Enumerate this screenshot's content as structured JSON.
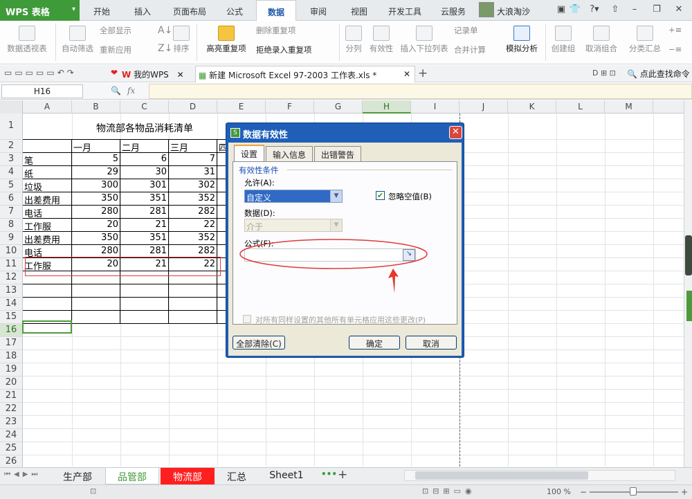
{
  "app": {
    "logo": "WPS 表格"
  },
  "menu_tabs": [
    "开始",
    "插入",
    "页面布局",
    "公式",
    "数据",
    "审阅",
    "视图",
    "开发工具",
    "云服务"
  ],
  "user_name": "大浪淘沙",
  "ribbon": {
    "pivot": "数据透视表",
    "autofilter": "自动筛选",
    "show_all": "全部显示",
    "reapply": "重新应用",
    "sort": "排序",
    "highlight_dup": "高亮重复项",
    "delete_dup": "删除重复项",
    "reject_dup": "拒绝录入重复项",
    "split": "分列",
    "validity": "有效性",
    "insert_dropdown": "插入下拉列表",
    "record": "记录单",
    "merge_calc": "合并计算",
    "simulate": "模拟分析",
    "create_group": "创建组",
    "ungroup": "取消组合",
    "subtotal": "分类汇总"
  },
  "doc_tabs": {
    "my_wps": "我的WPS",
    "file": "新建 Microsoft Excel 97-2003 工作表.xls *"
  },
  "search_cmd": "点此查找命令",
  "formula_bar": {
    "cell_ref": "H16",
    "fx": "fx"
  },
  "columns": [
    "A",
    "B",
    "C",
    "D",
    "E",
    "F",
    "G",
    "H",
    "I",
    "J",
    "K",
    "L",
    "M"
  ],
  "rows": [
    "1",
    "2",
    "3",
    "4",
    "5",
    "6",
    "7",
    "8",
    "9",
    "10",
    "11",
    "12",
    "13",
    "14",
    "15",
    "16",
    "17",
    "18",
    "19",
    "20",
    "21",
    "22",
    "23",
    "24",
    "25",
    "26"
  ],
  "sheet": {
    "title": "物流部各物品消耗清单",
    "months": [
      "一月",
      "二月",
      "三月",
      "四"
    ],
    "items": [
      {
        "name": "笔",
        "v": [
          "5",
          "6",
          "7"
        ]
      },
      {
        "name": "纸",
        "v": [
          "29",
          "30",
          "31"
        ]
      },
      {
        "name": "垃圾",
        "v": [
          "300",
          "301",
          "302"
        ]
      },
      {
        "name": "出差费用",
        "v": [
          "350",
          "351",
          "352"
        ]
      },
      {
        "name": "电话",
        "v": [
          "280",
          "281",
          "282"
        ]
      },
      {
        "name": "工作服",
        "v": [
          "20",
          "21",
          "22"
        ]
      },
      {
        "name": "出差费用",
        "v": [
          "350",
          "351",
          "352"
        ]
      },
      {
        "name": "电话",
        "v": [
          "280",
          "281",
          "282"
        ]
      },
      {
        "name": "工作服",
        "v": [
          "20",
          "21",
          "22"
        ]
      }
    ]
  },
  "dialog": {
    "title": "数据有效性",
    "tabs": [
      "设置",
      "输入信息",
      "出错警告"
    ],
    "section": "有效性条件",
    "allow_label": "允许(A):",
    "allow_value": "自定义",
    "ignore_blank": "忽略空值(B)",
    "data_label": "数据(D):",
    "data_value": "介于",
    "formula_label": "公式(F):",
    "formula_value": "",
    "apply_all": "对所有同样设置的其他所有单元格应用这些更改(P)",
    "clear_all": "全部清除(C)",
    "ok": "确定",
    "cancel": "取消"
  },
  "sheet_tabs": [
    "生产部",
    "品管部",
    "物流部",
    "汇总",
    "Sheet1"
  ],
  "status": {
    "zoom": "100 %"
  },
  "colors": {
    "accent_green": "#3f9a3a",
    "dialog_blue": "#1f5fb8",
    "annotation_red": "#e03a3a",
    "tab_red": "#ff1f1f"
  }
}
